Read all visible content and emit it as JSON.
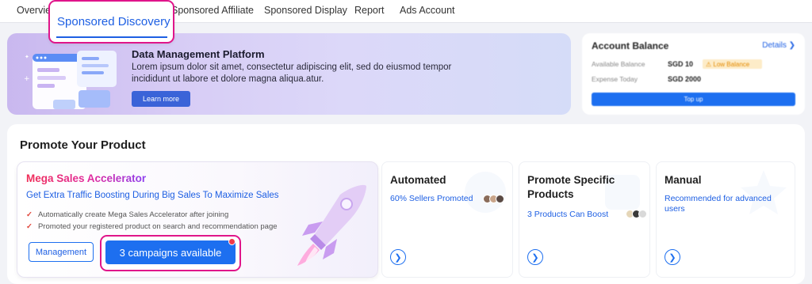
{
  "tabs": {
    "overview": "Overview",
    "active": "Sponsored Discovery",
    "affiliate": "Sponsored Affiliate",
    "display": "Sponsored Display",
    "report": "Report",
    "ads_account": "Ads Account"
  },
  "dmp": {
    "title": "Data Management Platform",
    "description": "Lorem ipsum dolor sit amet, consectetur adipiscing elit, sed do eiusmod tempor incididunt ut labore et dolore magna aliqua.atur.",
    "learn_more": "Learn more"
  },
  "account": {
    "title": "Account Balance",
    "details": "Details ❯",
    "available_label": "Available Balance",
    "available_value": "SGD 10",
    "low_balance": "Low Balance",
    "expense_label": "Expense Today",
    "expense_value": "SGD 2000",
    "topup": "Top up"
  },
  "promote": {
    "title": "Promote Your Product",
    "mega": {
      "title": "Mega Sales Accelerator",
      "subtitle": "Get Extra Traffic Boosting During Big Sales To Maximize Sales",
      "check1": "Automatically create Mega Sales Accelerator after joining",
      "check2": "Promoted your registered product on search and recommendation page",
      "management": "Management",
      "campaigns": "3 campaigns available"
    },
    "automated": {
      "title": "Automated",
      "sub": "60% Sellers Promoted"
    },
    "specific": {
      "title_line1": "Promote Specific",
      "title_line2": "Products",
      "sub": "3 Products Can Boost"
    },
    "manual": {
      "title": "Manual",
      "sub_line1": "Recommended for advanced",
      "sub_line2": "users"
    }
  },
  "icons": {
    "arrow": "circle-arrow-right-icon",
    "check": "check-icon",
    "warning": "warning-icon",
    "info": "info-icon"
  },
  "colors": {
    "accent": "#1d6ff0",
    "highlight": "#e0158a",
    "link": "#1d5fe3"
  }
}
